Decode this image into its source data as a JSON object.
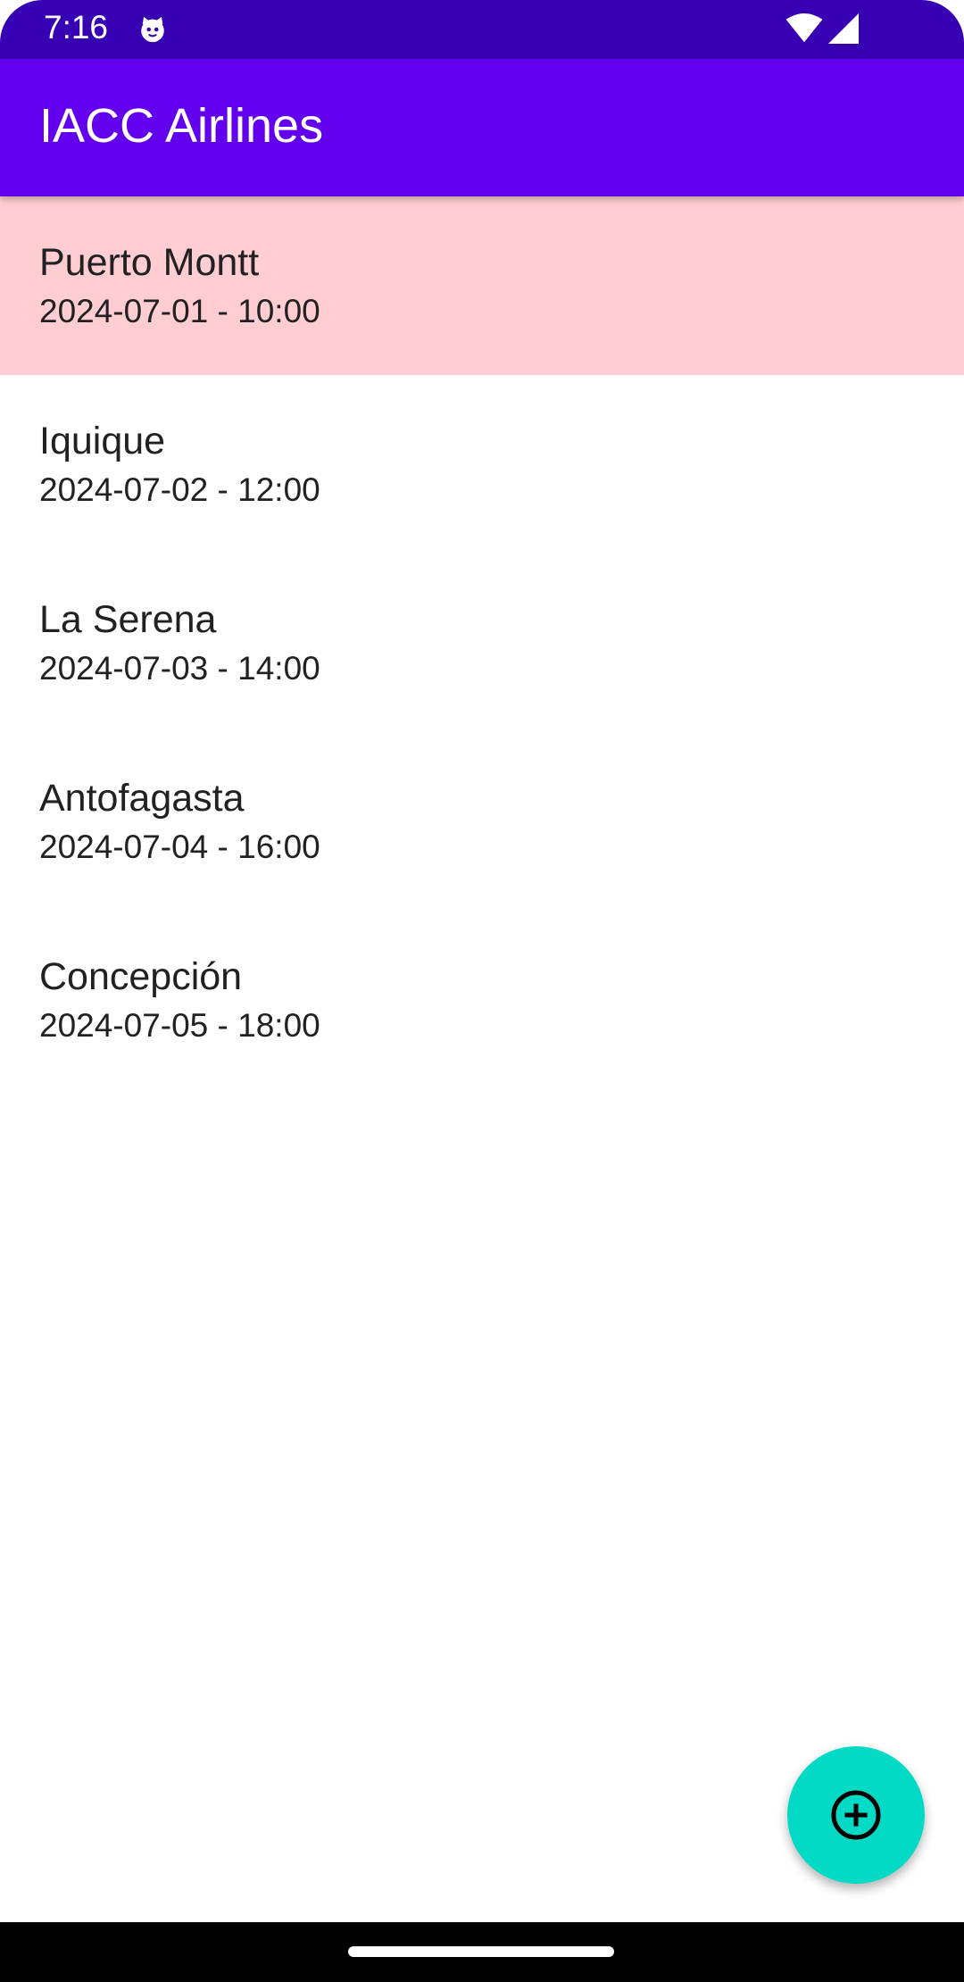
{
  "status_bar": {
    "time": "7:16",
    "icons": [
      "cat-notification-icon",
      "wifi-icon",
      "signal-icon"
    ],
    "background": "#3700B3"
  },
  "app_bar": {
    "title": "IACC Airlines",
    "background": "#6200EE"
  },
  "flights": [
    {
      "city": "Puerto Montt",
      "datetime": "2024-07-01 - 10:00",
      "highlighted": true
    },
    {
      "city": "Iquique",
      "datetime": "2024-07-02 - 12:00",
      "highlighted": false
    },
    {
      "city": "La Serena",
      "datetime": "2024-07-03 - 14:00",
      "highlighted": false
    },
    {
      "city": "Antofagasta",
      "datetime": "2024-07-04 - 16:00",
      "highlighted": false
    },
    {
      "city": "Concepción",
      "datetime": "2024-07-05 - 18:00",
      "highlighted": false
    }
  ],
  "highlight_color": "#FFCDD2",
  "fab": {
    "icon": "add-circle-icon",
    "background": "#03DAC5"
  }
}
